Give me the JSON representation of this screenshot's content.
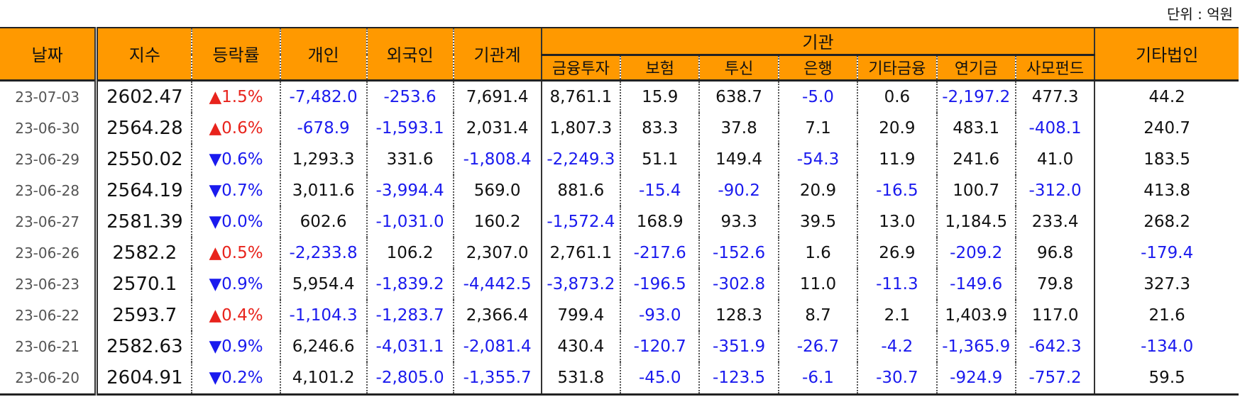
{
  "unit_label": "단위 : 억원",
  "headers": {
    "date": "날짜",
    "index": "지수",
    "change": "등락률",
    "individual": "개인",
    "foreign": "외국인",
    "inst_total": "기관계",
    "institution": "기관",
    "sub": [
      "금융투자",
      "보험",
      "투신",
      "은행",
      "기타금융",
      "연기금",
      "사모펀드"
    ],
    "other_corp": "기타법인"
  },
  "rows": [
    {
      "date": "23-07-03",
      "index": "2602.47",
      "dir": "up",
      "change": "1.5%",
      "individual": "-7,482.0",
      "foreign": "-253.6",
      "inst_total": "7,691.4",
      "sub": [
        "8,761.1",
        "15.9",
        "638.7",
        "-5.0",
        "0.6",
        "-2,197.2",
        "477.3"
      ],
      "other_corp": "44.2"
    },
    {
      "date": "23-06-30",
      "index": "2564.28",
      "dir": "up",
      "change": "0.6%",
      "individual": "-678.9",
      "foreign": "-1,593.1",
      "inst_total": "2,031.4",
      "sub": [
        "1,807.3",
        "83.3",
        "37.8",
        "7.1",
        "20.9",
        "483.1",
        "-408.1"
      ],
      "other_corp": "240.7"
    },
    {
      "date": "23-06-29",
      "index": "2550.02",
      "dir": "down",
      "change": "0.6%",
      "individual": "1,293.3",
      "foreign": "331.6",
      "inst_total": "-1,808.4",
      "sub": [
        "-2,249.3",
        "51.1",
        "149.4",
        "-54.3",
        "11.9",
        "241.6",
        "41.0"
      ],
      "other_corp": "183.5"
    },
    {
      "date": "23-06-28",
      "index": "2564.19",
      "dir": "down",
      "change": "0.7%",
      "individual": "3,011.6",
      "foreign": "-3,994.4",
      "inst_total": "569.0",
      "sub": [
        "881.6",
        "-15.4",
        "-90.2",
        "20.9",
        "-16.5",
        "100.7",
        "-312.0"
      ],
      "other_corp": "413.8"
    },
    {
      "date": "23-06-27",
      "index": "2581.39",
      "dir": "down",
      "change": "0.0%",
      "individual": "602.6",
      "foreign": "-1,031.0",
      "inst_total": "160.2",
      "sub": [
        "-1,572.4",
        "168.9",
        "93.3",
        "39.5",
        "13.0",
        "1,184.5",
        "233.4"
      ],
      "other_corp": "268.2"
    },
    {
      "date": "23-06-26",
      "index": "2582.2",
      "dir": "up",
      "change": "0.5%",
      "individual": "-2,233.8",
      "foreign": "106.2",
      "inst_total": "2,307.0",
      "sub": [
        "2,761.1",
        "-217.6",
        "-152.6",
        "1.6",
        "26.9",
        "-209.2",
        "96.8"
      ],
      "other_corp": "-179.4"
    },
    {
      "date": "23-06-23",
      "index": "2570.1",
      "dir": "down",
      "change": "0.9%",
      "individual": "5,954.4",
      "foreign": "-1,839.2",
      "inst_total": "-4,442.5",
      "sub": [
        "-3,873.2",
        "-196.5",
        "-302.8",
        "11.0",
        "-11.3",
        "-149.6",
        "79.8"
      ],
      "other_corp": "327.3"
    },
    {
      "date": "23-06-22",
      "index": "2593.7",
      "dir": "up",
      "change": "0.4%",
      "individual": "-1,104.3",
      "foreign": "-1,283.7",
      "inst_total": "2,366.4",
      "sub": [
        "799.4",
        "-93.0",
        "128.3",
        "8.7",
        "2.1",
        "1,403.9",
        "117.0"
      ],
      "other_corp": "21.6"
    },
    {
      "date": "23-06-21",
      "index": "2582.63",
      "dir": "down",
      "change": "0.9%",
      "individual": "6,246.6",
      "foreign": "-4,031.1",
      "inst_total": "-2,081.4",
      "sub": [
        "430.4",
        "-120.7",
        "-351.9",
        "-26.7",
        "-4.2",
        "-1,365.9",
        "-642.3"
      ],
      "other_corp": "-134.0"
    },
    {
      "date": "23-06-20",
      "index": "2604.91",
      "dir": "down",
      "change": "0.2%",
      "individual": "4,101.2",
      "foreign": "-2,805.0",
      "inst_total": "-1,355.7",
      "sub": [
        "531.8",
        "-45.0",
        "-123.5",
        "-6.1",
        "-30.7",
        "-924.9",
        "-757.2"
      ],
      "other_corp": "59.5"
    }
  ],
  "icons": {
    "up": "triangle-up-icon",
    "down": "triangle-down-icon"
  },
  "colors": {
    "header_bg": "#FF9900",
    "negative": "#1a1aee",
    "up": "#e8231c",
    "down": "#1a1aee"
  }
}
